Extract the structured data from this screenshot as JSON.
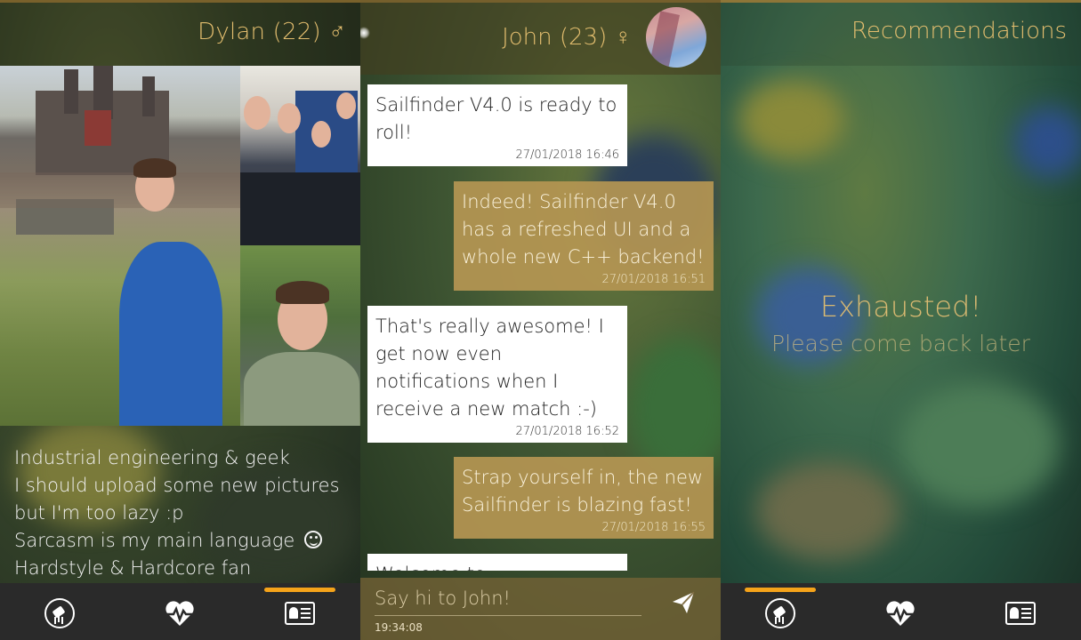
{
  "profile_screen": {
    "title": "Dylan (22) ♂",
    "bio": [
      "Industrial engineering & geek",
      "I should upload some new pictures",
      "but I'm too lazy :p",
      "Sarcasm is my main language",
      "Hardstyle & Hardcore fan"
    ],
    "active_tab": "profile"
  },
  "chat_screen": {
    "title": "John (23) ♀",
    "messages": [
      {
        "direction": "in",
        "text": "Sailfinder V4.0 is ready to roll!",
        "time": "27/01/2018 16:46"
      },
      {
        "direction": "out",
        "text": "Indeed! Sailfinder V4.0 has a refreshed UI and a whole new C++ backend!",
        "time": "27/01/2018 16:51"
      },
      {
        "direction": "in",
        "text": "That's really awesome! I get now even notifications when I receive a new match :-)",
        "time": "27/01/2018 16:52"
      },
      {
        "direction": "out",
        "text": "Strap yourself in, the new Sailfinder is blazing fast!",
        "time": "27/01/2018 16:55"
      },
      {
        "direction": "in",
        "text": "Welcome to",
        "time": ""
      }
    ],
    "composer": {
      "placeholder": "Say hi to John!",
      "time": "19:34:08"
    }
  },
  "recommendations_screen": {
    "title": "Recommendations",
    "empty_title": "Exhausted!",
    "empty_subtitle": "Please come back later",
    "active_tab": "recommendations"
  },
  "nav": {
    "items": [
      {
        "id": "recommendations",
        "icon": "telescope-icon"
      },
      {
        "id": "matches",
        "icon": "heart-pulse-icon"
      },
      {
        "id": "profile",
        "icon": "id-card-icon"
      }
    ]
  },
  "colors": {
    "accent": "#e2bd6e",
    "indicator": "#f5a31a",
    "nav_bg": "#2a2a2a",
    "bubble_out": "#b59652"
  }
}
